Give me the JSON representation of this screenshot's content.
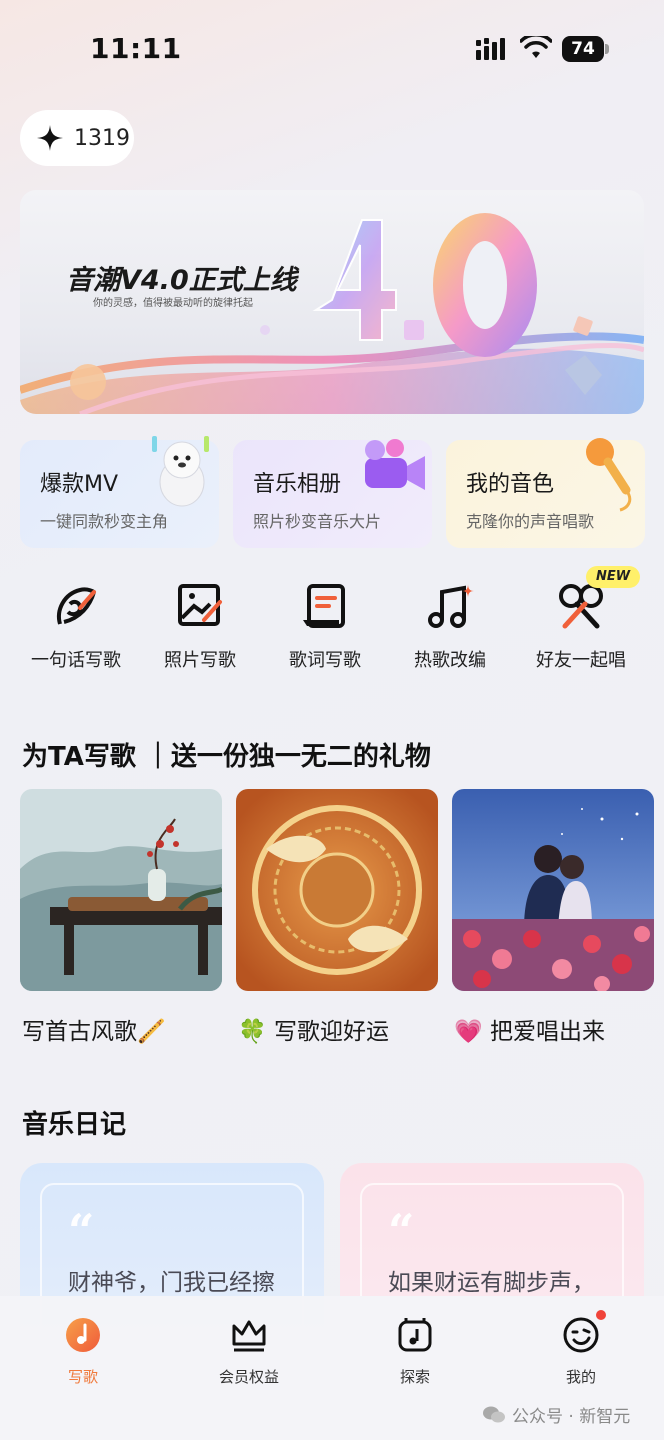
{
  "status_bar": {
    "time": "11:11",
    "battery": "74"
  },
  "points": {
    "value": "1319",
    "icon": "sparkle-icon"
  },
  "banner": {
    "title": "音潮V4.0正式上线",
    "subtitle": "你的灵感，值得被最动听的旋律托起"
  },
  "feature_cards": [
    {
      "title": "爆款MV",
      "subtitle": "一键同款秒变主角"
    },
    {
      "title": "音乐相册",
      "subtitle": "照片秒变音乐大片"
    },
    {
      "title": "我的音色",
      "subtitle": "克隆你的声音唱歌"
    }
  ],
  "tools": [
    {
      "label": "一句话写歌",
      "icon": "quill-icon"
    },
    {
      "label": "照片写歌",
      "icon": "photo-pen-icon"
    },
    {
      "label": "歌词写歌",
      "icon": "lyrics-scroll-icon"
    },
    {
      "label": "热歌改编",
      "icon": "music-note-sparkle-icon"
    },
    {
      "label": "好友一起唱",
      "icon": "duet-mic-icon"
    }
  ],
  "new_badge": "NEW",
  "gift_section": {
    "title": "为TA写歌 ｜送一份独一无二的礼物",
    "items": [
      {
        "caption": "写首古风歌🪈"
      },
      {
        "caption": "🍀 写歌迎好运"
      },
      {
        "caption": "💗 把爱唱出来"
      }
    ]
  },
  "diary_section": {
    "title": "音乐日记",
    "cards": [
      {
        "text": "财神爷，门我已经擦"
      },
      {
        "text": "如果财运有脚步声，"
      }
    ]
  },
  "tabbar": [
    {
      "label": "写歌",
      "icon": "music-disc-icon",
      "active": true
    },
    {
      "label": "会员权益",
      "icon": "crown-icon",
      "active": false
    },
    {
      "label": "探索",
      "icon": "explore-music-icon",
      "active": false
    },
    {
      "label": "我的",
      "icon": "profile-face-icon",
      "active": false
    }
  ],
  "watermark": "公众号 · 新智元",
  "colors": {
    "accent": "#f07a3c",
    "badge": "#fff06a",
    "notification": "#f0433a"
  }
}
